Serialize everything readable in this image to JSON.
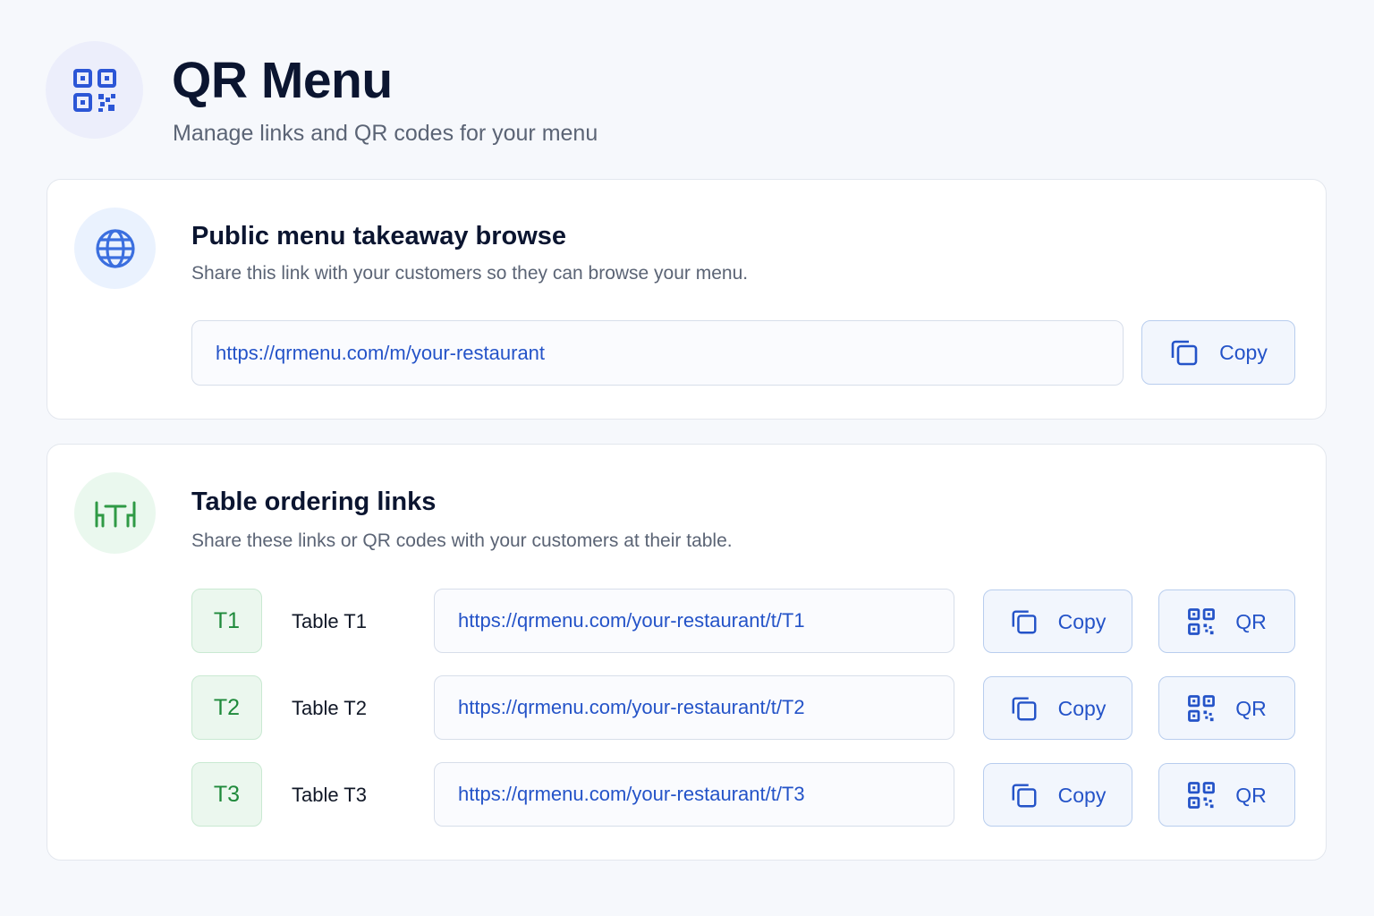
{
  "header": {
    "title": "QR Menu",
    "subtitle": "Manage links and QR codes for your menu",
    "icon": "qr-code-icon"
  },
  "public_menu": {
    "icon": "globe-icon",
    "title": "Public menu takeaway browse",
    "description": "Share this link with your customers so they can browse your menu.",
    "url": "https://qrmenu.com/m/your-restaurant",
    "copy_label": "Copy"
  },
  "table_links": {
    "icon": "table-icon",
    "title": "Table ordering links",
    "description": "Share these links or QR codes with your customers at their table.",
    "rows": [
      {
        "code": "T1",
        "label": "Table T1",
        "url": "https://qrmenu.com/your-restaurant/t/T1",
        "copy_label": "Copy",
        "qr_label": "QR"
      },
      {
        "code": "T2",
        "label": "Table T2",
        "url": "https://qrmenu.com/your-restaurant/t/T2",
        "copy_label": "Copy",
        "qr_label": "QR"
      },
      {
        "code": "T3",
        "label": "Table T3",
        "url": "https://qrmenu.com/your-restaurant/t/T3",
        "copy_label": "Copy",
        "qr_label": "QR"
      }
    ]
  },
  "colors": {
    "accent_blue": "#2453c8",
    "accent_green": "#1f8a3b",
    "background": "#f6f8fc"
  }
}
